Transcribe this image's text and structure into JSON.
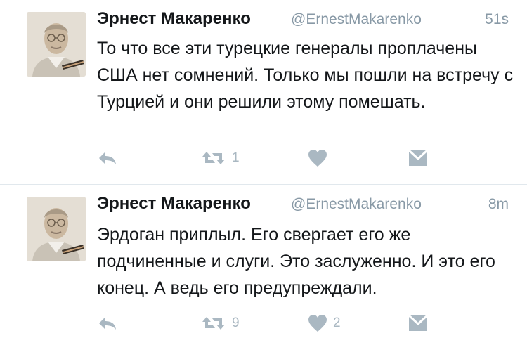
{
  "tweets": [
    {
      "author_name": "Эрнест Макаренко",
      "handle": "@ErnestMakarenko",
      "time": "51s",
      "text": "То что все эти турецкие генералы проплачены США нет сомнений. Только мы пошли на встречу с Турцией и они решили этому помешать.",
      "retweets": "1",
      "likes": "",
      "icons": {
        "reply": "reply-icon",
        "retweet": "retweet-icon",
        "like": "heart-icon",
        "dm": "envelope-icon"
      }
    },
    {
      "author_name": "Эрнест Макаренко",
      "handle": "@ErnestMakarenko",
      "time": "8m",
      "text": "Эрдоган приплыл. Его свергает его же подчиненные и слуги. Это заслуженно. И это его конец. А ведь его предупреждали.",
      "retweets": "9",
      "likes": "2",
      "icons": {
        "reply": "reply-icon",
        "retweet": "retweet-icon",
        "like": "heart-icon",
        "dm": "envelope-icon"
      }
    }
  ],
  "colors": {
    "icon": "#aab8c2",
    "text": "#14171a",
    "muted": "#8899a6",
    "divider": "#e1e8ed"
  }
}
